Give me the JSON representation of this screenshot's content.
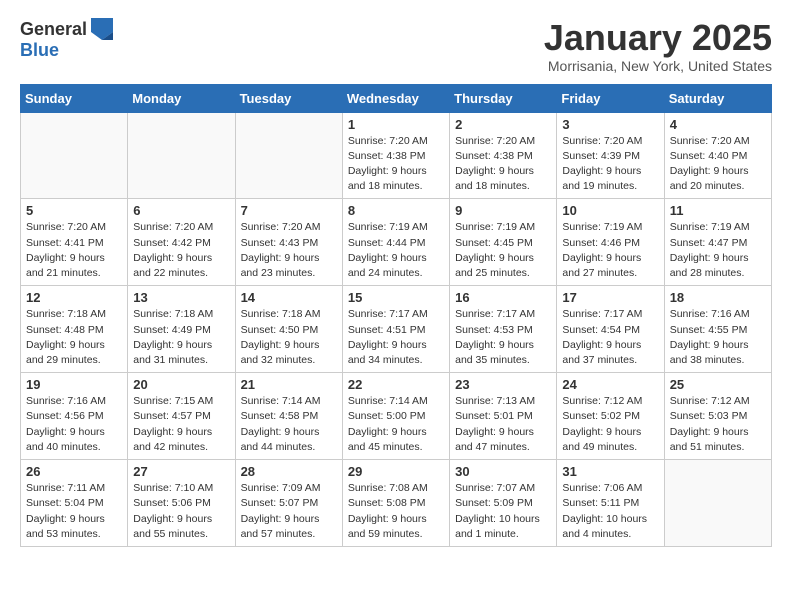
{
  "header": {
    "logo_general": "General",
    "logo_blue": "Blue",
    "month_title": "January 2025",
    "location": "Morrisania, New York, United States"
  },
  "days_of_week": [
    "Sunday",
    "Monday",
    "Tuesday",
    "Wednesday",
    "Thursday",
    "Friday",
    "Saturday"
  ],
  "weeks": [
    [
      {
        "day": "",
        "info": ""
      },
      {
        "day": "",
        "info": ""
      },
      {
        "day": "",
        "info": ""
      },
      {
        "day": "1",
        "info": "Sunrise: 7:20 AM\nSunset: 4:38 PM\nDaylight: 9 hours\nand 18 minutes."
      },
      {
        "day": "2",
        "info": "Sunrise: 7:20 AM\nSunset: 4:38 PM\nDaylight: 9 hours\nand 18 minutes."
      },
      {
        "day": "3",
        "info": "Sunrise: 7:20 AM\nSunset: 4:39 PM\nDaylight: 9 hours\nand 19 minutes."
      },
      {
        "day": "4",
        "info": "Sunrise: 7:20 AM\nSunset: 4:40 PM\nDaylight: 9 hours\nand 20 minutes."
      }
    ],
    [
      {
        "day": "5",
        "info": "Sunrise: 7:20 AM\nSunset: 4:41 PM\nDaylight: 9 hours\nand 21 minutes."
      },
      {
        "day": "6",
        "info": "Sunrise: 7:20 AM\nSunset: 4:42 PM\nDaylight: 9 hours\nand 22 minutes."
      },
      {
        "day": "7",
        "info": "Sunrise: 7:20 AM\nSunset: 4:43 PM\nDaylight: 9 hours\nand 23 minutes."
      },
      {
        "day": "8",
        "info": "Sunrise: 7:19 AM\nSunset: 4:44 PM\nDaylight: 9 hours\nand 24 minutes."
      },
      {
        "day": "9",
        "info": "Sunrise: 7:19 AM\nSunset: 4:45 PM\nDaylight: 9 hours\nand 25 minutes."
      },
      {
        "day": "10",
        "info": "Sunrise: 7:19 AM\nSunset: 4:46 PM\nDaylight: 9 hours\nand 27 minutes."
      },
      {
        "day": "11",
        "info": "Sunrise: 7:19 AM\nSunset: 4:47 PM\nDaylight: 9 hours\nand 28 minutes."
      }
    ],
    [
      {
        "day": "12",
        "info": "Sunrise: 7:18 AM\nSunset: 4:48 PM\nDaylight: 9 hours\nand 29 minutes."
      },
      {
        "day": "13",
        "info": "Sunrise: 7:18 AM\nSunset: 4:49 PM\nDaylight: 9 hours\nand 31 minutes."
      },
      {
        "day": "14",
        "info": "Sunrise: 7:18 AM\nSunset: 4:50 PM\nDaylight: 9 hours\nand 32 minutes."
      },
      {
        "day": "15",
        "info": "Sunrise: 7:17 AM\nSunset: 4:51 PM\nDaylight: 9 hours\nand 34 minutes."
      },
      {
        "day": "16",
        "info": "Sunrise: 7:17 AM\nSunset: 4:53 PM\nDaylight: 9 hours\nand 35 minutes."
      },
      {
        "day": "17",
        "info": "Sunrise: 7:17 AM\nSunset: 4:54 PM\nDaylight: 9 hours\nand 37 minutes."
      },
      {
        "day": "18",
        "info": "Sunrise: 7:16 AM\nSunset: 4:55 PM\nDaylight: 9 hours\nand 38 minutes."
      }
    ],
    [
      {
        "day": "19",
        "info": "Sunrise: 7:16 AM\nSunset: 4:56 PM\nDaylight: 9 hours\nand 40 minutes."
      },
      {
        "day": "20",
        "info": "Sunrise: 7:15 AM\nSunset: 4:57 PM\nDaylight: 9 hours\nand 42 minutes."
      },
      {
        "day": "21",
        "info": "Sunrise: 7:14 AM\nSunset: 4:58 PM\nDaylight: 9 hours\nand 44 minutes."
      },
      {
        "day": "22",
        "info": "Sunrise: 7:14 AM\nSunset: 5:00 PM\nDaylight: 9 hours\nand 45 minutes."
      },
      {
        "day": "23",
        "info": "Sunrise: 7:13 AM\nSunset: 5:01 PM\nDaylight: 9 hours\nand 47 minutes."
      },
      {
        "day": "24",
        "info": "Sunrise: 7:12 AM\nSunset: 5:02 PM\nDaylight: 9 hours\nand 49 minutes."
      },
      {
        "day": "25",
        "info": "Sunrise: 7:12 AM\nSunset: 5:03 PM\nDaylight: 9 hours\nand 51 minutes."
      }
    ],
    [
      {
        "day": "26",
        "info": "Sunrise: 7:11 AM\nSunset: 5:04 PM\nDaylight: 9 hours\nand 53 minutes."
      },
      {
        "day": "27",
        "info": "Sunrise: 7:10 AM\nSunset: 5:06 PM\nDaylight: 9 hours\nand 55 minutes."
      },
      {
        "day": "28",
        "info": "Sunrise: 7:09 AM\nSunset: 5:07 PM\nDaylight: 9 hours\nand 57 minutes."
      },
      {
        "day": "29",
        "info": "Sunrise: 7:08 AM\nSunset: 5:08 PM\nDaylight: 9 hours\nand 59 minutes."
      },
      {
        "day": "30",
        "info": "Sunrise: 7:07 AM\nSunset: 5:09 PM\nDaylight: 10 hours\nand 1 minute."
      },
      {
        "day": "31",
        "info": "Sunrise: 7:06 AM\nSunset: 5:11 PM\nDaylight: 10 hours\nand 4 minutes."
      },
      {
        "day": "",
        "info": ""
      }
    ]
  ]
}
